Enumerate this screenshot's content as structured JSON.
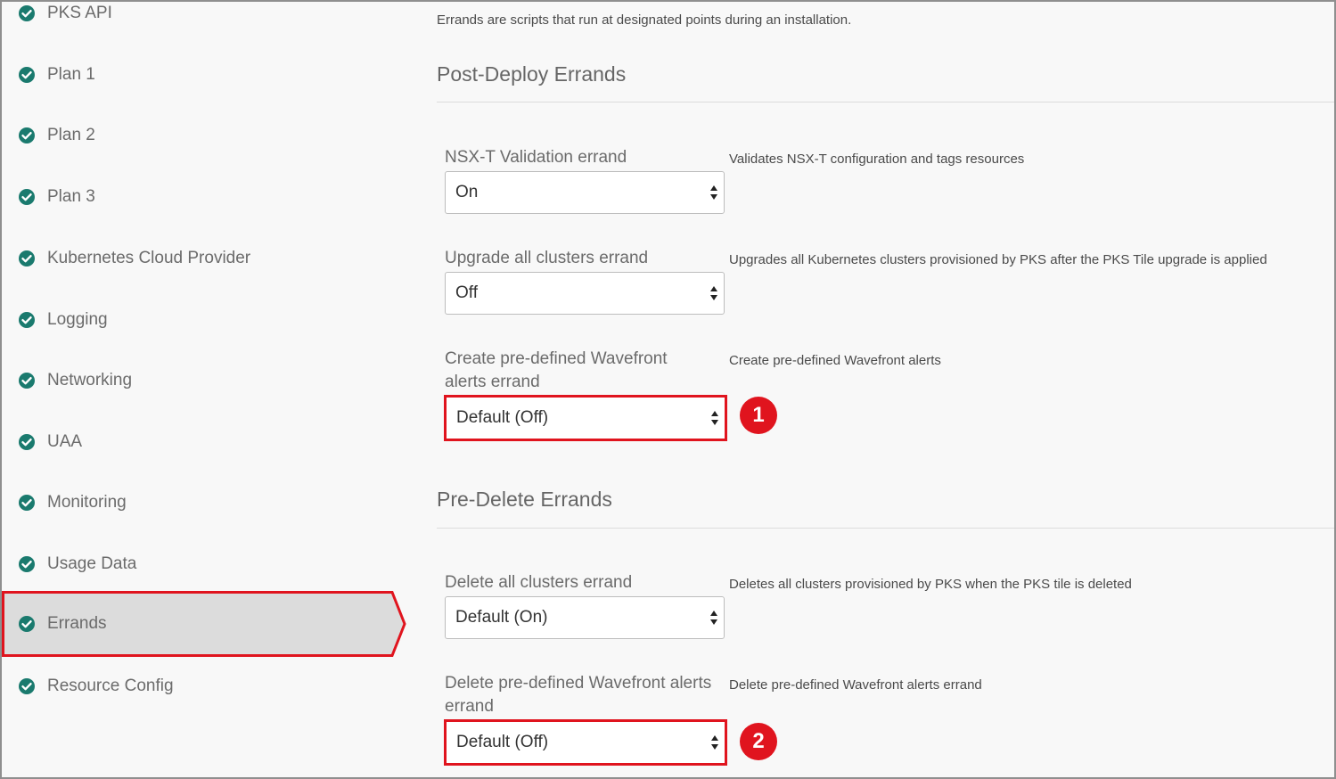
{
  "sidebar": {
    "items": [
      {
        "label": "PKS API"
      },
      {
        "label": "Plan 1"
      },
      {
        "label": "Plan 2"
      },
      {
        "label": "Plan 3"
      },
      {
        "label": "Kubernetes Cloud Provider"
      },
      {
        "label": "Logging"
      },
      {
        "label": "Networking"
      },
      {
        "label": "UAA"
      },
      {
        "label": "Monitoring"
      },
      {
        "label": "Usage Data"
      },
      {
        "label": "Errands",
        "active": true
      },
      {
        "label": "Resource Config"
      }
    ],
    "check_icon": "check-circle-icon",
    "check_color": "#1a7a6e"
  },
  "main": {
    "intro": "Errands are scripts that run at designated points during an installation.",
    "post_deploy": {
      "title": "Post-Deploy Errands",
      "fields": [
        {
          "label": "NSX-T Validation errand",
          "value": "On",
          "description": "Validates NSX-T configuration and tags resources"
        },
        {
          "label": "Upgrade all clusters errand",
          "value": "Off",
          "description": "Upgrades all Kubernetes clusters provisioned by PKS after the PKS Tile upgrade is applied"
        },
        {
          "label": "Create pre-defined Wavefront alerts errand",
          "value": "Default (Off)",
          "description": "Create pre-defined Wavefront alerts",
          "callout": "1"
        }
      ]
    },
    "pre_delete": {
      "title": "Pre-Delete Errands",
      "fields": [
        {
          "label": "Delete all clusters errand",
          "value": "Default (On)",
          "description": "Deletes all clusters provisioned by PKS when the PKS tile is deleted"
        },
        {
          "label": "Delete pre-defined Wavefront alerts errand",
          "value": "Default (Off)",
          "description": "Delete pre-defined Wavefront alerts errand",
          "callout": "2"
        }
      ]
    }
  },
  "colors": {
    "highlight": "#e0141e",
    "active_bg": "#dcdcdc"
  }
}
